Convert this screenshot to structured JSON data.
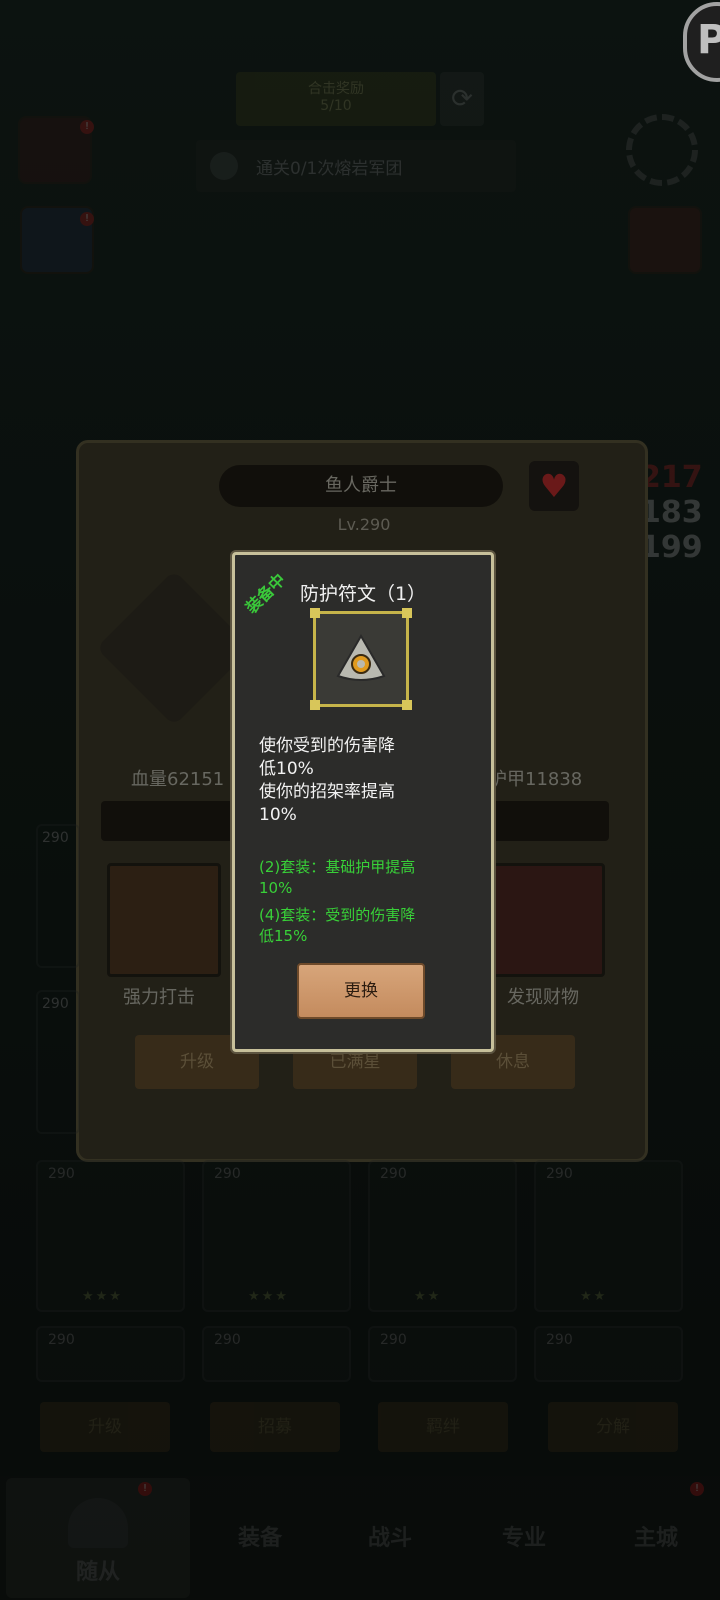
{
  "top": {
    "banner_label": "合击奖励",
    "banner_value": "5/10",
    "quest_text": "通关0/1次熔岩军团"
  },
  "hero_panel": {
    "name": "鱼人爵士",
    "level": "Lv.290",
    "hp_label": "血量62151",
    "armor_label": "护甲11838",
    "skill_left_label": "强力打击",
    "skill_right_label": "发现财物",
    "buttons": {
      "upgrade": "升级",
      "max_star": "已满星",
      "rest": "休息"
    }
  },
  "side_numbers": [
    "217",
    "183",
    "199"
  ],
  "modal": {
    "equipped_tag": "装备中",
    "title": "防护符文（1）",
    "description": "使你受到的伤害降\n低10%\n使你的招架率提高\n10%",
    "set_bonus_2": "(2)套装：基础护甲提高\n10%",
    "set_bonus_4": "(4)套装：受到的伤害降\n低15%",
    "swap_button": "更换"
  },
  "cards_row1": [
    {
      "level": "290",
      "stars": "★★★"
    },
    {
      "level": "290",
      "stars": "★★★"
    },
    {
      "level": "290",
      "stars": "★★"
    },
    {
      "level": "290",
      "stars": "★★"
    }
  ],
  "cards_row2": [
    {
      "level": "290"
    },
    {
      "level": "290"
    },
    {
      "level": "290"
    },
    {
      "level": "290"
    }
  ],
  "left_column_levels": [
    "290",
    "290"
  ],
  "tabs": [
    "升级",
    "招募",
    "羁绊",
    "分解"
  ],
  "nav": [
    "随从",
    "装备",
    "战斗",
    "专业",
    "主城"
  ],
  "colors": {
    "modal_border": "#c7c09a",
    "set_bonus_green": "#38d038",
    "item_frame_gold": "#c6b44a",
    "swap_button": "#c48b5e"
  }
}
